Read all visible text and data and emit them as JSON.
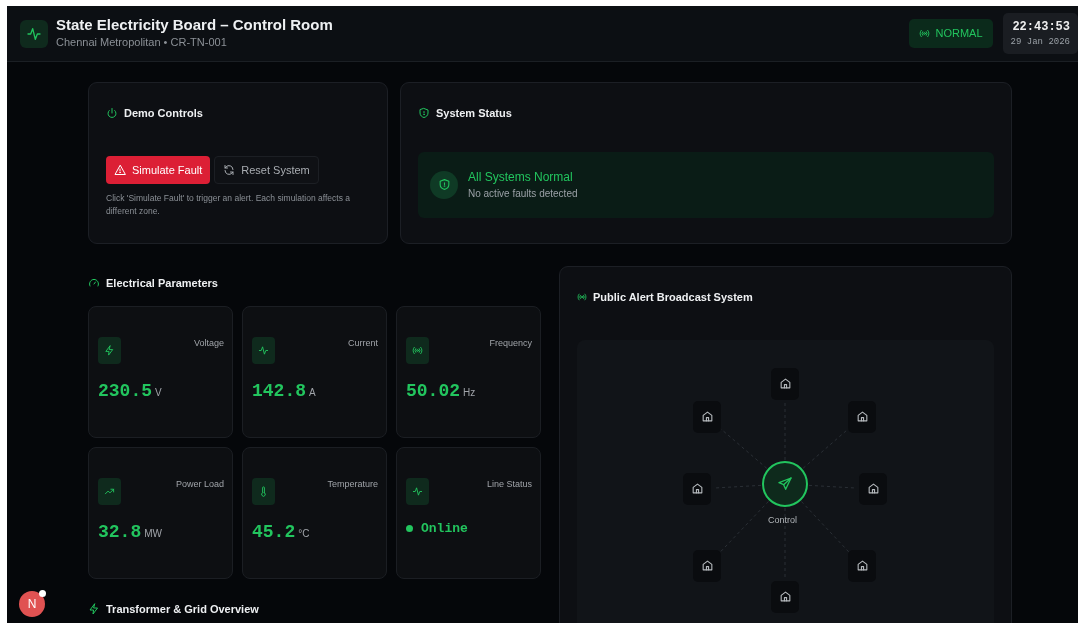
{
  "header": {
    "title": "State Electricity Board – Control Room",
    "subtitle": "Chennai Metropolitan • CR-TN-001",
    "status_badge": "NORMAL",
    "time": "22:43:53",
    "date": "29 Jan 2026"
  },
  "demo_controls": {
    "title": "Demo Controls",
    "buttons": [
      {
        "label": "Simulate Fault",
        "kind": "danger"
      },
      {
        "label": "Reset System",
        "kind": "secondary"
      }
    ],
    "hint": "Click 'Simulate Fault' to trigger an alert. Each simulation affects a different zone."
  },
  "system_status": {
    "title": "System Status",
    "status_title": "All Systems Normal",
    "status_text": "No active faults detected"
  },
  "electrical_parameters": {
    "title": "Electrical Parameters",
    "cards": [
      {
        "kind": "reading",
        "label": "Voltage",
        "value": "230.5",
        "unit": "V"
      },
      {
        "kind": "reading",
        "label": "Current",
        "value": "142.8",
        "unit": "A"
      },
      {
        "kind": "reading",
        "label": "Frequency",
        "value": "50.02",
        "unit": "Hz"
      },
      {
        "kind": "reading",
        "label": "Power Load",
        "value": "32.8",
        "unit": "MW"
      },
      {
        "kind": "reading",
        "label": "Temperature",
        "value": "45.2",
        "unit": "°C"
      },
      {
        "kind": "status",
        "label": "Line Status",
        "value": "Online"
      }
    ]
  },
  "broadcast": {
    "title": "Public Alert Broadcast System",
    "center_label": "Control"
  },
  "transformer": {
    "title": "Transformer & Grid Overview"
  },
  "avatar": {
    "letter": "N"
  }
}
